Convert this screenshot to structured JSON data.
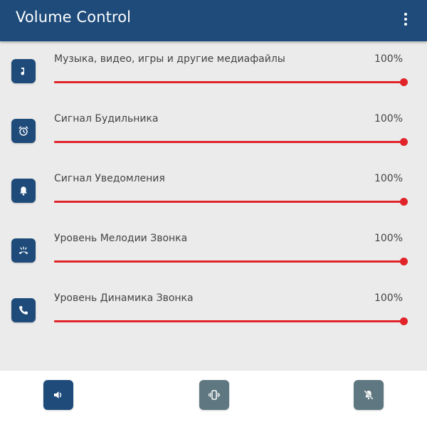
{
  "app": {
    "title": "Volume Control",
    "menu_icon": "more-vert-icon"
  },
  "colors": {
    "primary": "#1e4b7a",
    "accent": "#e0242a",
    "muted_button": "#5f7780"
  },
  "streams": [
    {
      "label": "Музыка, видео, игры и другие медиафайлы",
      "value_text": "100%",
      "level": 1.0,
      "icon": "music-note-icon"
    },
    {
      "label": "Сигнал Будильника",
      "value_text": "100%",
      "level": 1.0,
      "icon": "alarm-clock-icon"
    },
    {
      "label": "Сигнал Уведомления",
      "value_text": "100%",
      "level": 1.0,
      "icon": "bell-icon"
    },
    {
      "label": "Уровень Мелодии Звонка",
      "value_text": "100%",
      "level": 1.0,
      "icon": "ringing-phone-icon"
    },
    {
      "label": "Уровень Динамика Звонка",
      "value_text": "100%",
      "level": 1.0,
      "icon": "phone-icon"
    }
  ],
  "modes": [
    {
      "name": "sound",
      "icon": "speaker-icon",
      "active": true
    },
    {
      "name": "vibrate",
      "icon": "vibrate-icon",
      "active": false
    },
    {
      "name": "silent",
      "icon": "bell-off-icon",
      "active": false
    }
  ]
}
